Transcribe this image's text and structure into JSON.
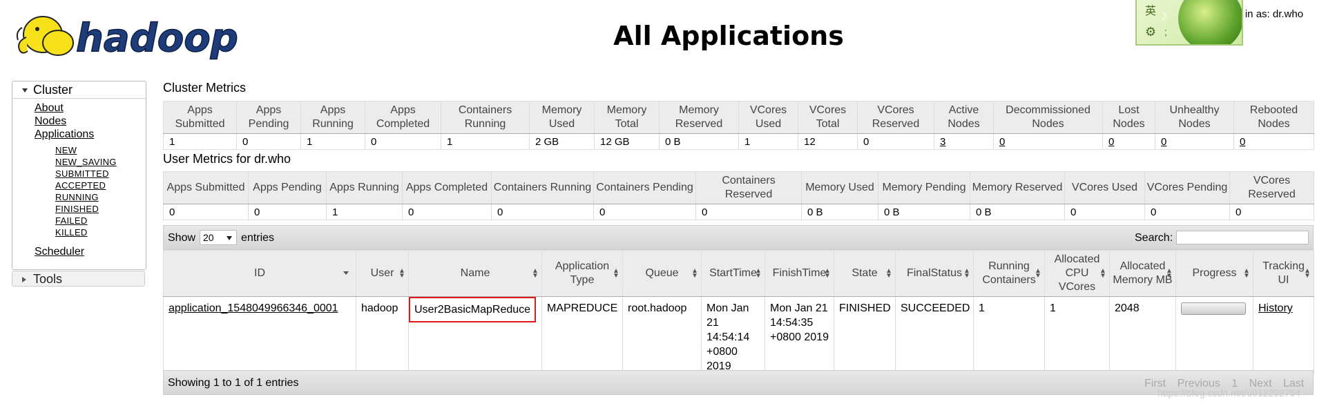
{
  "header": {
    "title": "All Applications",
    "logo_text": "hadoop",
    "logged_in": "ed in as: dr.who"
  },
  "sidebar": {
    "cluster": {
      "label": "Cluster",
      "links": [
        "About",
        "Nodes",
        "Applications"
      ],
      "app_states": [
        "NEW",
        "NEW_SAVING",
        "SUBMITTED",
        "ACCEPTED",
        "RUNNING",
        "FINISHED",
        "FAILED",
        "KILLED"
      ],
      "scheduler": "Scheduler"
    },
    "tools": {
      "label": "Tools"
    }
  },
  "cluster_metrics": {
    "title": "Cluster Metrics",
    "headers": [
      "Apps Submitted",
      "Apps Pending",
      "Apps Running",
      "Apps Completed",
      "Containers Running",
      "Memory Used",
      "Memory Total",
      "Memory Reserved",
      "VCores Used",
      "VCores Total",
      "VCores Reserved",
      "Active Nodes",
      "Decommissioned Nodes",
      "Lost Nodes",
      "Unhealthy Nodes",
      "Rebooted Nodes"
    ],
    "values": [
      "1",
      "0",
      "1",
      "0",
      "1",
      "2 GB",
      "12 GB",
      "0 B",
      "1",
      "12",
      "0",
      "3",
      "0",
      "0",
      "0",
      "0"
    ]
  },
  "user_metrics": {
    "title": "User Metrics for dr.who",
    "headers": [
      "Apps Submitted",
      "Apps Pending",
      "Apps Running",
      "Apps Completed",
      "Containers Running",
      "Containers Pending",
      "Containers Reserved",
      "Memory Used",
      "Memory Pending",
      "Memory Reserved",
      "VCores Used",
      "VCores Pending",
      "VCores Reserved"
    ],
    "values": [
      "0",
      "0",
      "1",
      "0",
      "0",
      "0",
      "0",
      "0 B",
      "0 B",
      "0 B",
      "0",
      "0",
      "0"
    ]
  },
  "apps": {
    "show_label": "Show",
    "entries_value": "20",
    "entries_label": "entries",
    "search_label": "Search:",
    "columns": [
      "ID",
      "User",
      "Name",
      "Application Type",
      "Queue",
      "StartTime",
      "FinishTime",
      "State",
      "FinalStatus",
      "Running Containers",
      "Allocated CPU VCores",
      "Allocated Memory MB",
      "Progress",
      "Tracking UI"
    ],
    "row": {
      "id": "application_1548049966346_0001",
      "user": "hadoop",
      "name": "User2BasicMapReduce",
      "type": "MAPREDUCE",
      "queue": "root.hadoop",
      "start": "Mon Jan 21 14:54:14 +0800 2019",
      "finish": "Mon Jan 21 14:54:35 +0800 2019",
      "state": "FINISHED",
      "final_status": "SUCCEEDED",
      "running_containers": "1",
      "alloc_vcores": "1",
      "alloc_memory": "2048",
      "progress": 1.0,
      "tracking": "History"
    },
    "footer": "Showing 1 to 1 of 1 entries",
    "pager": [
      "First",
      "Previous",
      "1",
      "Next",
      "Last"
    ]
  },
  "watermark": "https://blog.csdn.net/u012292754"
}
